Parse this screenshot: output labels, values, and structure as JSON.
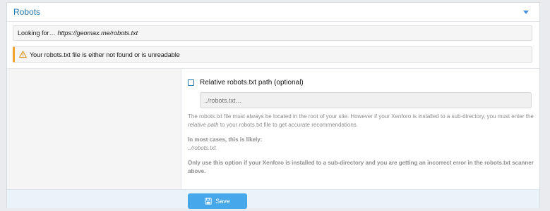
{
  "panel": {
    "title": "Robots"
  },
  "looking": {
    "prefix": "Looking for…",
    "url": "https://geomax.me/robots.txt"
  },
  "warning": {
    "icon": "warning-icon",
    "text": "Your robots.txt file is either not found or is unreadable",
    "accent_color": "#f3a32b"
  },
  "form": {
    "checkbox_label": "Relative robots.txt path (optional)",
    "checkbox_checked": false,
    "input_value": "",
    "input_placeholder": "../robots.txt…",
    "explain_part1": "The robots.txt file must always be located in the root of your site. However if your Xenforo is installed to a sub-directory, you must enter the ",
    "explain_em": "relative path",
    "explain_part2": " to your robots.txt file to get accurate recommendations.",
    "likely_heading": "In most cases, this is likely:",
    "likely_value": "../robots.txt",
    "only_use": "Only use this option if your Xenforo is installed to a sub-directory and you are getting an incorrect error in the robots.txt scanner above."
  },
  "footer": {
    "save_label": "Save",
    "save_icon": "save-icon"
  },
  "colors": {
    "accent": "#2577b1",
    "button": "#47a7eb"
  }
}
